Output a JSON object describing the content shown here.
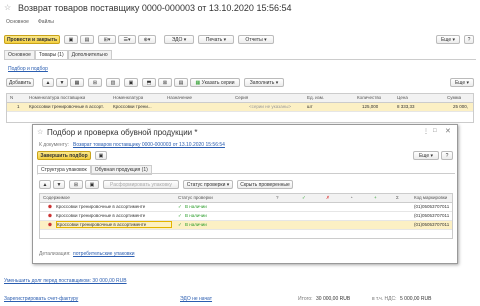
{
  "window_title": "Возврат товаров поставщику 0000-000003 от 13.10.2020 15:56:54",
  "nav_tabs": [
    "Основное",
    "Файлы"
  ],
  "toolbar": {
    "post_close": "Провести и закрыть",
    "edo": "ЭДО",
    "print": "Печать",
    "reports": "Отчеты",
    "more": "Еще"
  },
  "doc_tabs": [
    "Основное",
    "Товары (1)",
    "Дополнительно"
  ],
  "selection_link": "Подбор и подбор",
  "goods_toolbar": {
    "add": "Добавить",
    "set_series": "Указать серии",
    "fill": "Заполнить",
    "more": "Еще"
  },
  "goods_columns": [
    "N",
    "Номенклатура поставщика",
    "Номенклатура",
    "Назначение",
    "Серия",
    "Ед. изм.",
    "Количество",
    "Цена",
    "Сумма"
  ],
  "goods_rows": [
    {
      "n": "1",
      "supplier_item": "Кроссовки тренировочные в ассорт.",
      "item": "Кроссовки трени...",
      "purpose": "",
      "series": "<серии не указаны>",
      "unit": "шт",
      "qty": "125,000",
      "price": "8 333,33",
      "sum": "25 000,"
    }
  ],
  "dialog": {
    "title": "Подбор и проверка обувной продукции *",
    "subtitle_prefix": "К документу:",
    "doc_link": "Возврат товаров поставщику 0000-000003 от 13.10.2020 15:56:54",
    "finish_btn": "Завершить подбор",
    "more": "Еще",
    "help": "?",
    "tabs": [
      "Структура упаковок",
      "Обувная продукция (1)"
    ],
    "toolbar": {
      "disband": "Расформировать упаковку",
      "check_status": "Статус проверки",
      "hide_checked": "Скрыть проверенные"
    },
    "columns": [
      "Содержимое",
      "Статус проверки",
      "?",
      "✓",
      "✗",
      "◔",
      "+",
      "Σ",
      "Код маркировки"
    ],
    "rows": [
      {
        "content": "Кроссовки тренировочные в ассортименте",
        "status": "В наличии",
        "code": "(01)05053707011"
      },
      {
        "content": "Кроссовки тренировочные в ассортименте",
        "status": "В наличии",
        "code": "(01)05053707011"
      },
      {
        "content": "Кроссовки тренировочные в ассортименте",
        "status": "В наличии",
        "code": "(01)05053707011"
      }
    ],
    "detail_label": "Детализация:",
    "detail_link": "потребительские упаковки"
  },
  "footer": {
    "debt_link": "Уменьшить долг перед поставщиком: 30 000,00 RUB",
    "register_link": "Зарегистрировать счет-фактуру",
    "edo_link": "ЭДО не начат",
    "total_label": "Итого:",
    "total_value": "30 000,00 RUB",
    "vat_label": "в т.ч. НДС:",
    "vat_value": "5 000,00 RUB"
  }
}
